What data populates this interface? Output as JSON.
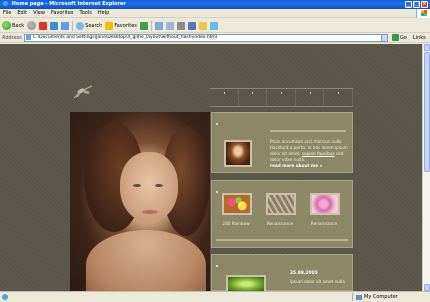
{
  "window": {
    "title": "Home page - Microsoft Internet Explorer"
  },
  "menu": [
    "File",
    "Edit",
    "View",
    "Favorites",
    "Tools",
    "Help"
  ],
  "toolbar": {
    "back_label": "Back",
    "search_label": "Search",
    "favorites_label": "Favorites"
  },
  "address": {
    "label": "Address",
    "url": "C:\\Documents and Settings\\Jane\\Desktop\\4_gime_layout\\without_flash\\index.html",
    "go_label": "Go",
    "links_label": "Links"
  },
  "site": {
    "featured": {
      "text_before": "Proin accumsan orci rhoncus nulla tincidunt a porta. In nec lorem ipsum dolor sit amet, ",
      "text_link": "sapien faucibus",
      "text_after": " sed dolor vitae nulla.",
      "more": "read more about me »"
    },
    "gallery": [
      {
        "label": "240 Rainbow"
      },
      {
        "label": "Renaissance"
      },
      {
        "label": "Renaissance"
      }
    ],
    "news": {
      "date": "25.08.2005",
      "text": "Ipsum dolor sit amet nulla"
    }
  },
  "status": {
    "zone": "My Computer"
  }
}
